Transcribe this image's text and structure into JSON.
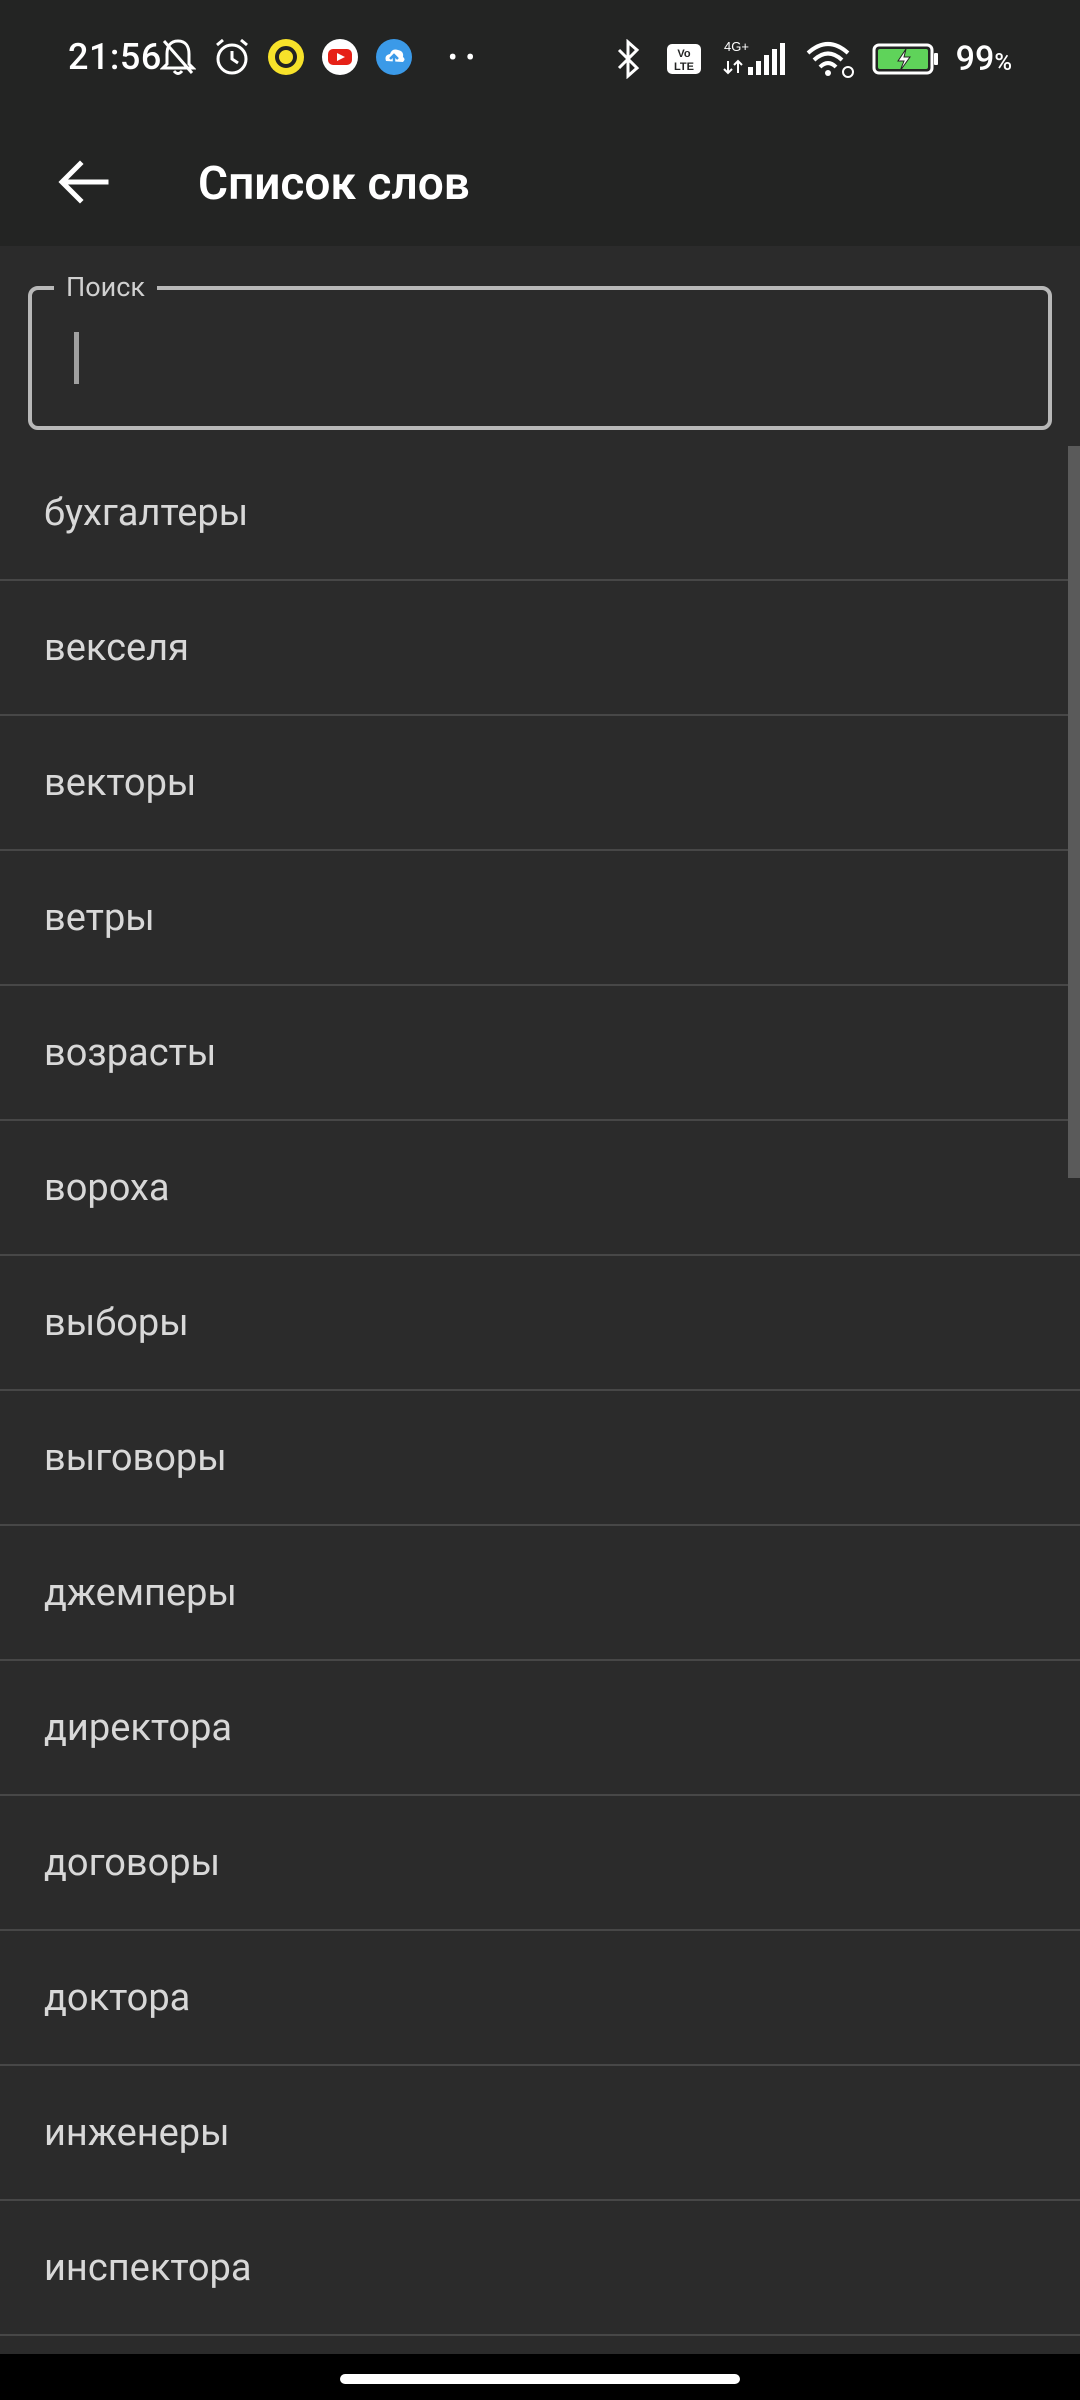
{
  "status_bar": {
    "time": "21:56",
    "battery_percent": "99",
    "battery_unit": "%",
    "network_label": "4G+",
    "volte_label": "Vo LTE"
  },
  "app_bar": {
    "title": "Список слов"
  },
  "search": {
    "label": "Поиск",
    "value": ""
  },
  "words": [
    "бухгалтеры",
    "векселя",
    "векторы",
    "ветры",
    "возрасты",
    "вороха",
    "выборы",
    "выговоры",
    "джемперы",
    "директора",
    "договоры",
    "доктора",
    "инженеры",
    "инспектора"
  ],
  "colors": {
    "background": "#2b2b2b",
    "app_bar": "#232423",
    "divider": "#474747",
    "text": "#d8d8d8"
  }
}
